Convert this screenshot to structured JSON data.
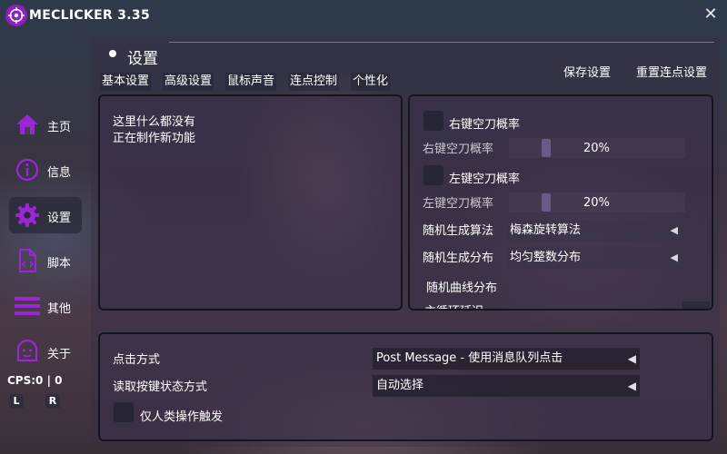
{
  "app": {
    "title": "MECLICKER 3.35"
  },
  "sidebar": {
    "items": [
      {
        "label": "主页"
      },
      {
        "label": "信息"
      },
      {
        "label": "设置"
      },
      {
        "label": "脚本"
      },
      {
        "label": "其他"
      },
      {
        "label": "关于"
      }
    ],
    "active": "设置",
    "cps": "CPS:0 | 0",
    "left_button": "L",
    "right_button": "R"
  },
  "header": {
    "title": "设置",
    "save_label": "保存设置",
    "reset_label": "重置连点设置"
  },
  "tabs": [
    "基本设置",
    "高级设置",
    "鼠标声音",
    "连点控制",
    "个性化"
  ],
  "left_panel": {
    "line1": "这里什么都没有",
    "line2": "正在制作新功能"
  },
  "right_panel": {
    "right_knife_label": "右键空刀概率",
    "right_knife_rate_label": "右键空刀概率",
    "right_knife_rate_value": "20%",
    "left_knife_label": "左键空刀概率",
    "left_knife_rate_label": "左键空刀概率",
    "left_knife_rate_value": "20%",
    "algo_label": "随机生成算法",
    "algo_value": "梅森旋转算法",
    "dist_label": "随机生成分布",
    "dist_value": "均匀整数分布",
    "curve_label": "随机曲线分布",
    "cutoff_label": "主循环延迟"
  },
  "bottom_panel": {
    "click_mode_label": "点击方式",
    "click_mode_value": "Post Message - 使用消息队列点击",
    "read_key_label": "读取按键状态方式",
    "read_key_value": "自动选择",
    "human_only_label": "仅人类操作触发"
  },
  "colors": {
    "accent": "#9b26d6",
    "panel_border": "#15151c"
  },
  "icons": [
    "logo-icon",
    "close-icon",
    "home-icon",
    "info-icon",
    "gear-icon",
    "script-icon",
    "menu-icon",
    "ghost-icon",
    "dropdown-arrow-icon"
  ]
}
